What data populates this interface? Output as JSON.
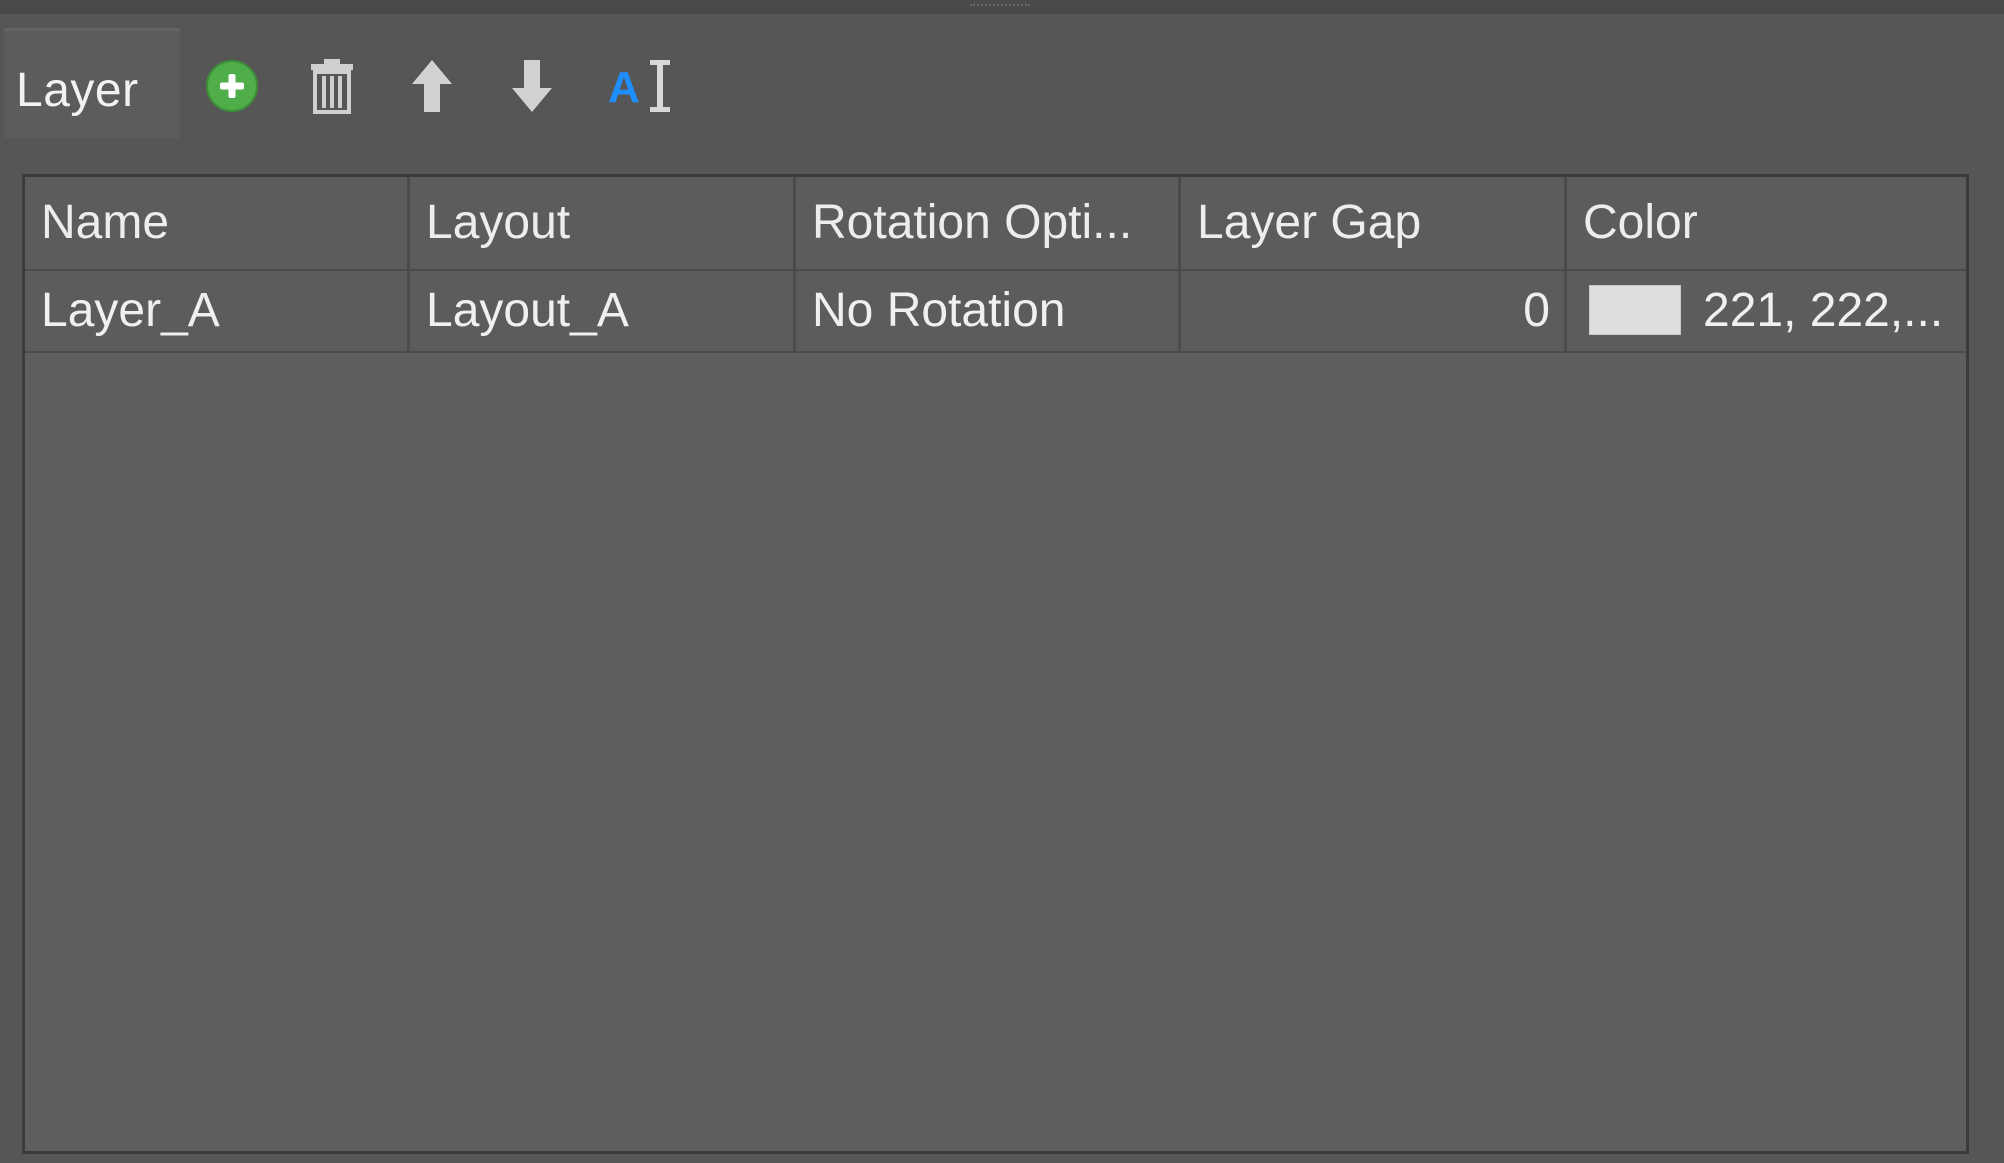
{
  "panel": {
    "title": "Layer"
  },
  "toolbar": {
    "buttons": [
      {
        "name": "add-layer",
        "icon": "plus-circle-icon",
        "color": "#4caf50"
      },
      {
        "name": "delete-layer",
        "icon": "trash-icon",
        "color": "#cfcfcf"
      },
      {
        "name": "move-up",
        "icon": "arrow-up-icon",
        "color": "#cfcfcf"
      },
      {
        "name": "move-down",
        "icon": "arrow-down-icon",
        "color": "#cfcfcf"
      },
      {
        "name": "rename",
        "icon": "text-cursor-icon",
        "color": "#1e90ff"
      }
    ]
  },
  "table": {
    "columns": [
      "Name",
      "Layout",
      "Rotation Opti...",
      "Layer Gap",
      "Color"
    ],
    "rows": [
      {
        "name": "Layer_A",
        "layout": "Layout_A",
        "rotation": "No Rotation",
        "gap": "0",
        "color_swatch": "#dddee0",
        "color_text": "221, 222,..."
      }
    ]
  }
}
